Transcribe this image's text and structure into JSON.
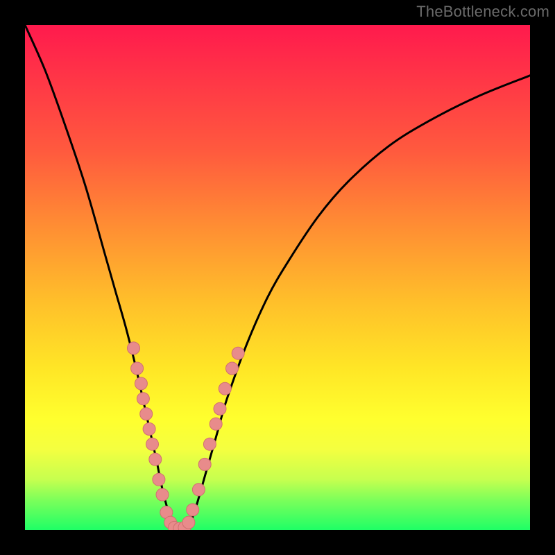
{
  "attribution": "TheBottleneck.com",
  "colors": {
    "frame": "#000000",
    "curve": "#000000",
    "dot_fill": "#e88b8b",
    "dot_stroke": "#d07070"
  },
  "chart_data": {
    "type": "line",
    "title": "",
    "xlabel": "",
    "ylabel": "",
    "xlim": [
      0,
      100
    ],
    "ylim": [
      0,
      100
    ],
    "series": [
      {
        "name": "bottleneck-curve",
        "x": [
          0,
          4,
          8,
          12,
          16,
          18,
          20,
          22,
          24,
          26,
          27,
          28,
          29,
          30,
          31,
          32,
          33,
          34,
          36,
          38,
          40,
          44,
          48,
          52,
          58,
          64,
          72,
          80,
          90,
          100
        ],
        "values": [
          100,
          91,
          80,
          68,
          54,
          47,
          40,
          32,
          23,
          14,
          9,
          5,
          2,
          0,
          0,
          0,
          2,
          5,
          12,
          19,
          26,
          37,
          46,
          53,
          62,
          69,
          76,
          81,
          86,
          90
        ]
      }
    ],
    "scatter_overlay": {
      "name": "sample-dots",
      "points": [
        {
          "x": 21.5,
          "y": 36
        },
        {
          "x": 22.2,
          "y": 32
        },
        {
          "x": 23.0,
          "y": 29
        },
        {
          "x": 23.4,
          "y": 26
        },
        {
          "x": 24.0,
          "y": 23
        },
        {
          "x": 24.6,
          "y": 20
        },
        {
          "x": 25.2,
          "y": 17
        },
        {
          "x": 25.8,
          "y": 14
        },
        {
          "x": 26.5,
          "y": 10
        },
        {
          "x": 27.2,
          "y": 7
        },
        {
          "x": 28.0,
          "y": 3.5
        },
        {
          "x": 28.8,
          "y": 1.5
        },
        {
          "x": 29.6,
          "y": 0.5
        },
        {
          "x": 30.6,
          "y": 0.3
        },
        {
          "x": 31.6,
          "y": 0.5
        },
        {
          "x": 32.4,
          "y": 1.5
        },
        {
          "x": 33.2,
          "y": 4
        },
        {
          "x": 34.4,
          "y": 8
        },
        {
          "x": 35.6,
          "y": 13
        },
        {
          "x": 36.6,
          "y": 17
        },
        {
          "x": 37.8,
          "y": 21
        },
        {
          "x": 38.6,
          "y": 24
        },
        {
          "x": 39.6,
          "y": 28
        },
        {
          "x": 41.0,
          "y": 32
        },
        {
          "x": 42.2,
          "y": 35
        }
      ]
    },
    "grid": false,
    "legend": false
  }
}
